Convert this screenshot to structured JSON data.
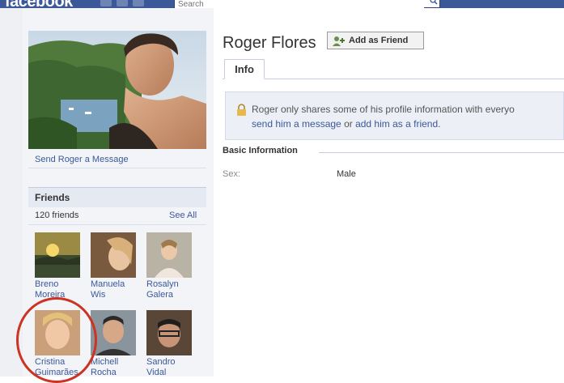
{
  "header": {
    "logo": "facebook",
    "search_placeholder": "Search"
  },
  "profile": {
    "name": "Roger Flores",
    "add_friend_label": "Add as Friend",
    "send_message": "Send Roger a Message"
  },
  "tabs": [
    {
      "label": "Info"
    }
  ],
  "notice": {
    "line1": "Roger only shares some of his profile information with everyo",
    "line2_before": "send him a message",
    "line2_mid": " or ",
    "line2_link2": "add him as a friend",
    "line2_end": "."
  },
  "basic_info": {
    "title": "Basic Information",
    "fields": [
      {
        "label": "Sex:",
        "value": "Male"
      }
    ]
  },
  "friends": {
    "title": "Friends",
    "count": "120 friends",
    "see_all": "See All",
    "items": [
      {
        "line1": "Breno",
        "line2": "Moreira"
      },
      {
        "line1": "Manuela",
        "line2": "Wis"
      },
      {
        "line1": "Rosalyn",
        "line2": "Galera"
      },
      {
        "line1": "Cristina",
        "line2": "Guimarães"
      },
      {
        "line1": "Michell",
        "line2": "Rocha"
      },
      {
        "line1": "Sandro",
        "line2": "Vidal"
      }
    ]
  },
  "colors": {
    "brand": "#3b5998",
    "highlight": "#cc3322",
    "page_bg": "#eef0f4"
  }
}
